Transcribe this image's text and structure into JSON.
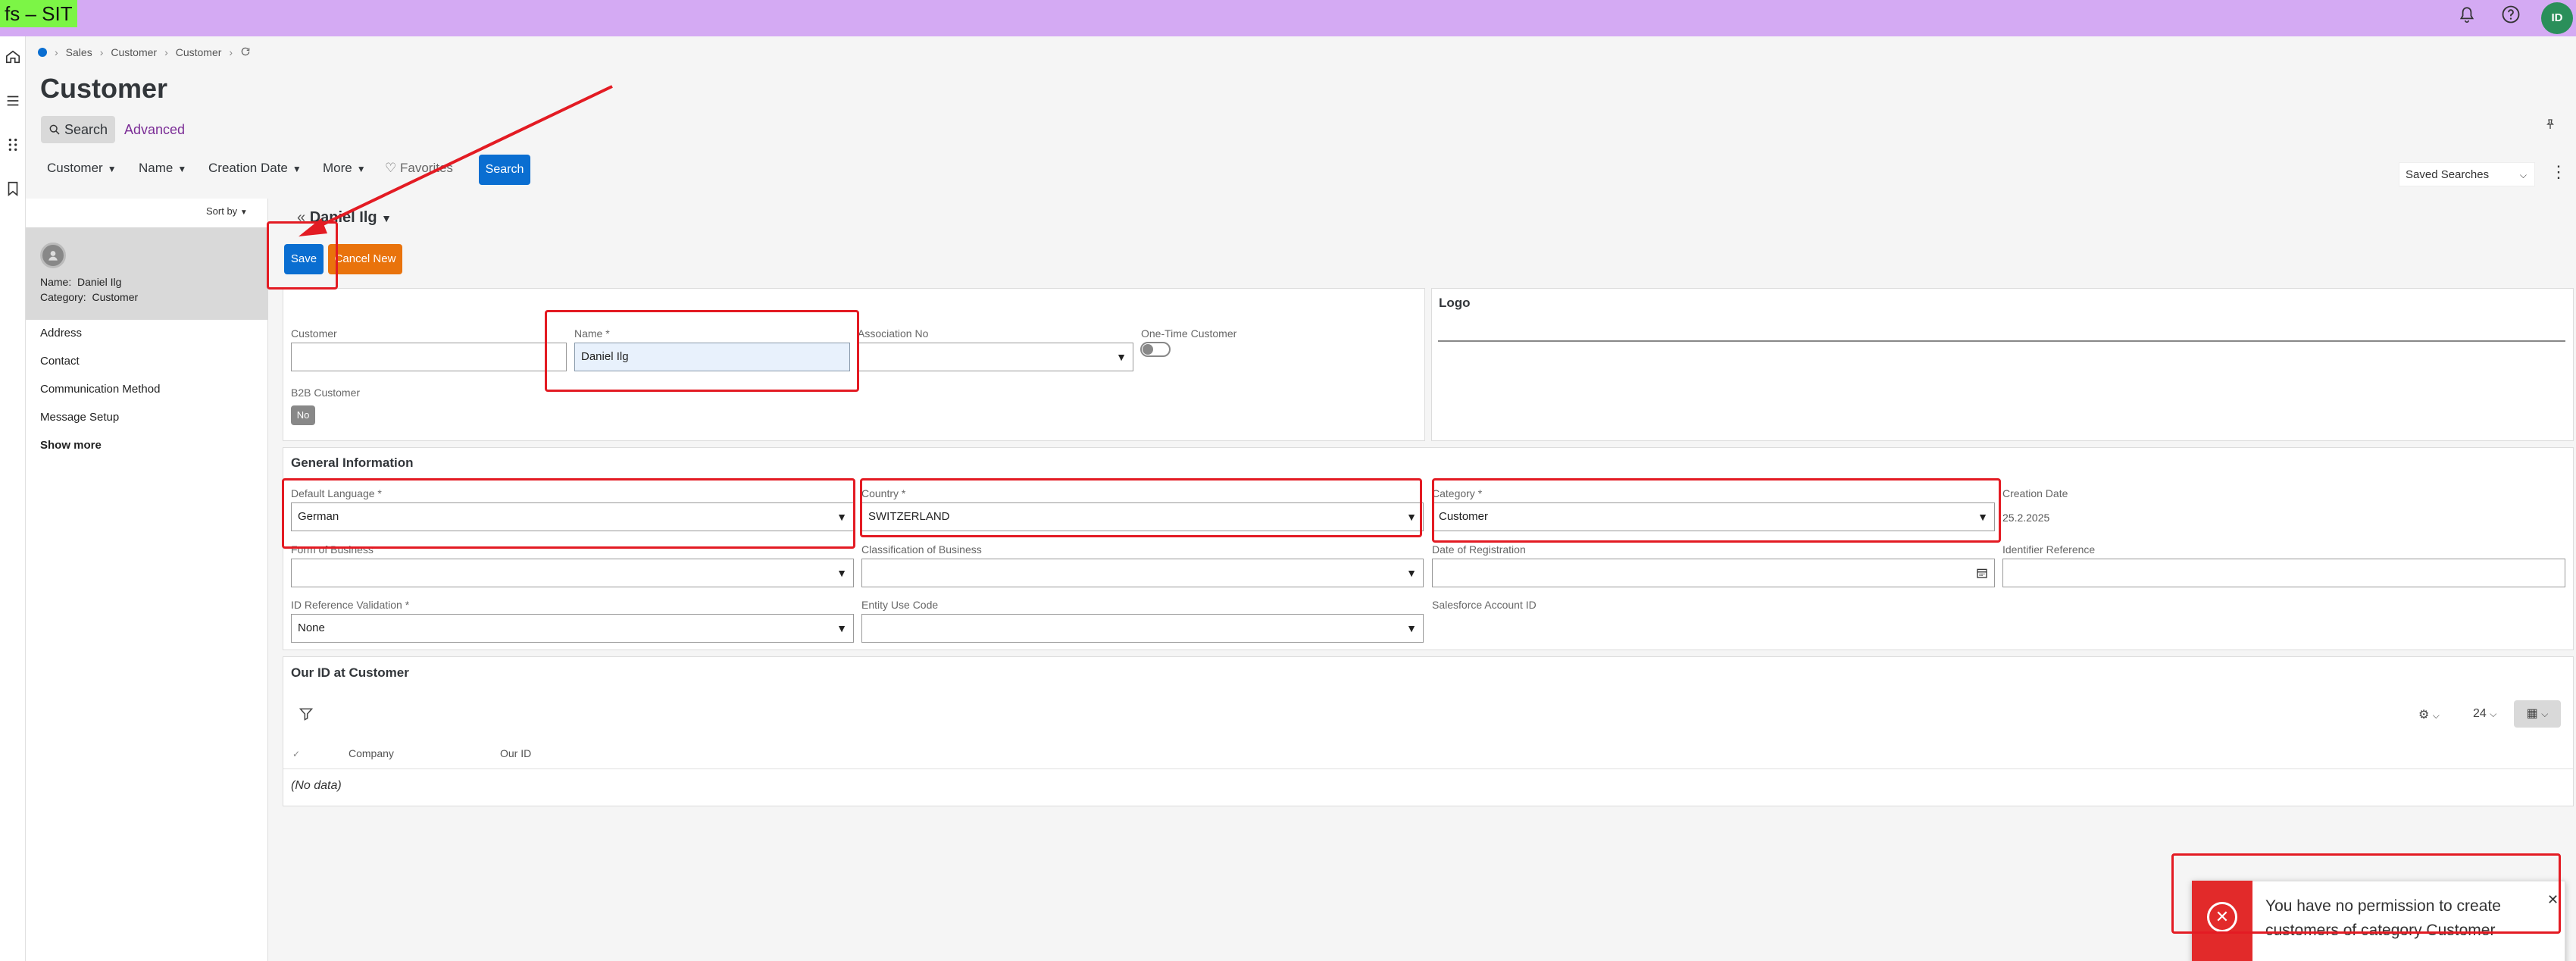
{
  "env_tag": "fs – SIT",
  "topbar": {
    "avatar_initials": "ID"
  },
  "breadcrumb": [
    "Sales",
    "Customer",
    "Customer"
  ],
  "page": {
    "title": "Customer"
  },
  "search_tabs": {
    "search": "Search",
    "advanced": "Advanced"
  },
  "filters": {
    "customer": "Customer",
    "name": "Name",
    "creation_date": "Creation Date",
    "more": "More",
    "favorites": "Favorites",
    "search_button": "Search",
    "saved_searches": "Saved Searches"
  },
  "list": {
    "sort_by": "Sort by",
    "card": {
      "name_label": "Name:",
      "name_value": "Daniel Ilg",
      "category_label": "Category:",
      "category_value": "Customer"
    },
    "nav_items": [
      "Address",
      "Contact",
      "Communication Method",
      "Message Setup"
    ],
    "show_more": "Show more"
  },
  "record": {
    "title": "Daniel Ilg",
    "save": "Save",
    "cancel_new": "Cancel New"
  },
  "header_section": {
    "customer_label": "Customer",
    "customer_value": "",
    "name_label": "Name *",
    "name_value": "Daniel Ilg",
    "association_label": "Association No",
    "association_value": "",
    "onetime_label": "One-Time Customer",
    "b2b_label": "B2B Customer",
    "b2b_value": "No",
    "logo_label": "Logo"
  },
  "general": {
    "title": "General Information",
    "default_language_label": "Default Language *",
    "default_language_value": "German",
    "country_label": "Country *",
    "country_value": "SWITZERLAND",
    "category_label": "Category *",
    "category_value": "Customer",
    "creation_date_label": "Creation Date",
    "creation_date_value": "25.2.2025",
    "form_business_label": "Form of Business",
    "classification_label": "Classification of Business",
    "date_registration_label": "Date of Registration",
    "identifier_label": "Identifier Reference",
    "id_ref_validation_label": "ID Reference Validation *",
    "id_ref_validation_value": "None",
    "entity_use_label": "Entity Use Code",
    "salesforce_label": "Salesforce Account ID"
  },
  "our_id": {
    "title": "Our ID at Customer",
    "page_size": "24",
    "columns": [
      "Company",
      "Our ID"
    ],
    "empty": "(No data)"
  },
  "toast": {
    "message": "You have no permission to create customers of category Customer"
  },
  "colors": {
    "accent": "#0a6ed1",
    "cancel": "#e9730c",
    "highlight": "#e31b23",
    "topbar": "#d4aaf3",
    "env_tag": "#7cf546"
  },
  "icons": {
    "topbar": [
      "bell-icon",
      "help-icon"
    ],
    "leftnav": [
      "home-icon",
      "menu-icon",
      "apps-icon",
      "bookmark-icon"
    ]
  }
}
